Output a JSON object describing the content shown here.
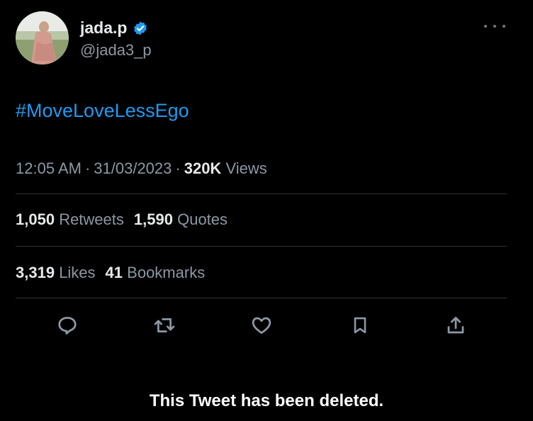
{
  "author": {
    "display_name": "jada.p",
    "handle": "@jada3_p",
    "verified_icon": "verified-badge-icon",
    "avatar": "profile-photo"
  },
  "tweet": {
    "text": "#MoveLoveLessEgo",
    "time": "12:05 AM",
    "date": "31/03/2023",
    "views_count": "320K",
    "views_label": "Views",
    "separator": "·"
  },
  "stats": {
    "retweets_count": "1,050",
    "retweets_label": "Retweets",
    "quotes_count": "1,590",
    "quotes_label": "Quotes",
    "likes_count": "3,319",
    "likes_label": "Likes",
    "bookmarks_count": "41",
    "bookmarks_label": "Bookmarks"
  },
  "actions": [
    "reply-icon",
    "retweet-icon",
    "like-icon",
    "bookmark-icon",
    "share-icon"
  ],
  "overlay_caption": "This Tweet has been deleted.",
  "colors": {
    "background": "#000000",
    "text_primary": "#e7e9ea",
    "text_secondary": "#8b98a5",
    "accent": "#1d9bf0",
    "divider": "#2f3336"
  }
}
